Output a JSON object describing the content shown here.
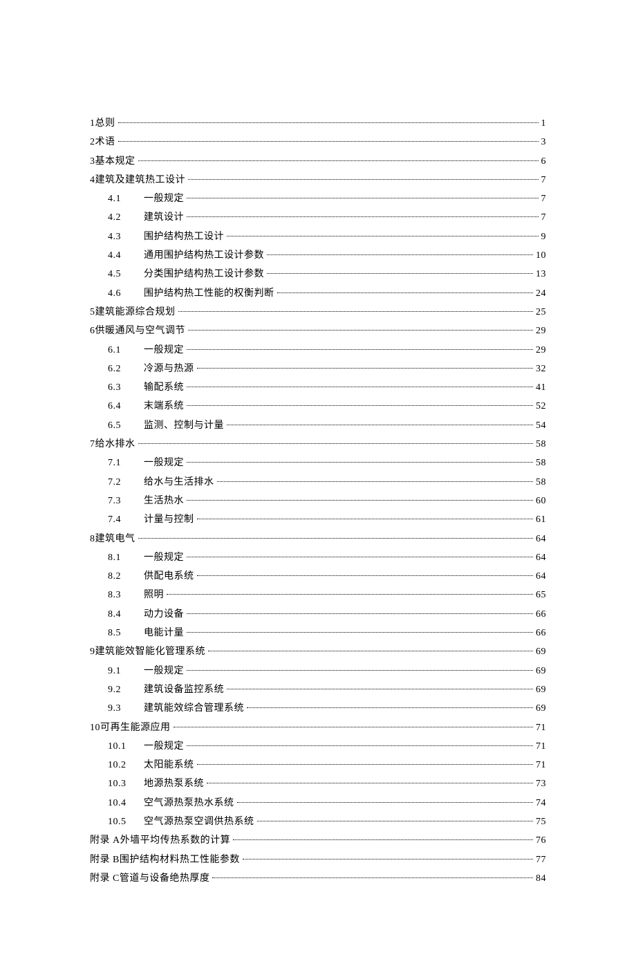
{
  "toc": [
    {
      "level": 0,
      "num": "1",
      "title": "总则",
      "page": "1"
    },
    {
      "level": 0,
      "num": "2",
      "title": "术语",
      "page": "3"
    },
    {
      "level": 0,
      "num": "3",
      "title": "基本规定",
      "page": "6"
    },
    {
      "level": 0,
      "num": "4",
      "title": "建筑及建筑热工设计",
      "page": "7"
    },
    {
      "level": 1,
      "num": "4.1",
      "title": "一般规定",
      "page": "7"
    },
    {
      "level": 1,
      "num": "4.2",
      "title": "建筑设计",
      "page": "7"
    },
    {
      "level": 1,
      "num": "4.3",
      "title": "围护结构热工设计",
      "page": "9"
    },
    {
      "level": 1,
      "num": "4.4",
      "title": "通用围护结构热工设计参数",
      "page": "10"
    },
    {
      "level": 1,
      "num": "4.5",
      "title": "分类围护结构热工设计参数",
      "page": "13"
    },
    {
      "level": 1,
      "num": "4.6",
      "title": "围护结构热工性能的权衡判断",
      "page": "24"
    },
    {
      "level": 0,
      "num": "5",
      "title": "建筑能源综合规划",
      "page": "25"
    },
    {
      "level": 0,
      "num": "6",
      "title": "供暖通风与空气调节",
      "page": "29"
    },
    {
      "level": 1,
      "num": "6.1",
      "title": "一般规定",
      "page": "29"
    },
    {
      "level": 1,
      "num": "6.2",
      "title": "冷源与热源",
      "page": "32"
    },
    {
      "level": 1,
      "num": "6.3",
      "title": "输配系统",
      "page": "41"
    },
    {
      "level": 1,
      "num": "6.4",
      "title": "末端系统",
      "page": "52"
    },
    {
      "level": 1,
      "num": "6.5",
      "title": "监测、控制与计量",
      "page": "54"
    },
    {
      "level": 0,
      "num": "7",
      "title": "给水排水",
      "page": "58"
    },
    {
      "level": 1,
      "num": "7.1",
      "title": "一般规定",
      "page": "58"
    },
    {
      "level": 1,
      "num": "7.2",
      "title": "给水与生活排水",
      "page": "58"
    },
    {
      "level": 1,
      "num": "7.3",
      "title": "生活热水",
      "page": "60"
    },
    {
      "level": 1,
      "num": "7.4",
      "title": "计量与控制",
      "page": "61"
    },
    {
      "level": 0,
      "num": "8",
      "title": "建筑电气",
      "page": "64"
    },
    {
      "level": 1,
      "num": "8.1",
      "title": "一般规定",
      "page": "64"
    },
    {
      "level": 1,
      "num": "8.2",
      "title": "供配电系统",
      "page": "64"
    },
    {
      "level": 1,
      "num": "8.3",
      "title": "照明",
      "page": "65"
    },
    {
      "level": 1,
      "num": "8.4",
      "title": "动力设备",
      "page": "66"
    },
    {
      "level": 1,
      "num": "8.5",
      "title": "电能计量",
      "page": "66"
    },
    {
      "level": 0,
      "num": "9",
      "title": "建筑能效智能化管理系统",
      "page": "69"
    },
    {
      "level": 1,
      "num": "9.1",
      "title": "一般规定",
      "page": "69"
    },
    {
      "level": 1,
      "num": "9.2",
      "title": "建筑设备监控系统",
      "page": "69"
    },
    {
      "level": 1,
      "num": "9.3",
      "title": "建筑能效综合管理系统",
      "page": "69"
    },
    {
      "level": 0,
      "num": "10",
      "title": "可再生能源应用",
      "page": "71"
    },
    {
      "level": 1,
      "num": "10.1",
      "title": "一般规定",
      "page": "71"
    },
    {
      "level": 1,
      "num": "10.2",
      "title": "太阳能系统",
      "page": "71"
    },
    {
      "level": 1,
      "num": "10.3",
      "title": "地源热泵系统",
      "page": "73"
    },
    {
      "level": 1,
      "num": "10.4",
      "title": "空气源热泵热水系统",
      "page": "74"
    },
    {
      "level": 1,
      "num": "10.5",
      "title": "空气源热泵空调供热系统",
      "page": "75"
    },
    {
      "level": 0,
      "num": "附录 A",
      "title": "外墙平均传热系数的计算",
      "page": "76"
    },
    {
      "level": 0,
      "num": "附录 B",
      "title": "围护结构材料热工性能参数",
      "page": "77"
    },
    {
      "level": 0,
      "num": "附录 C",
      "title": "管道与设备绝热厚度",
      "page": "84"
    }
  ]
}
